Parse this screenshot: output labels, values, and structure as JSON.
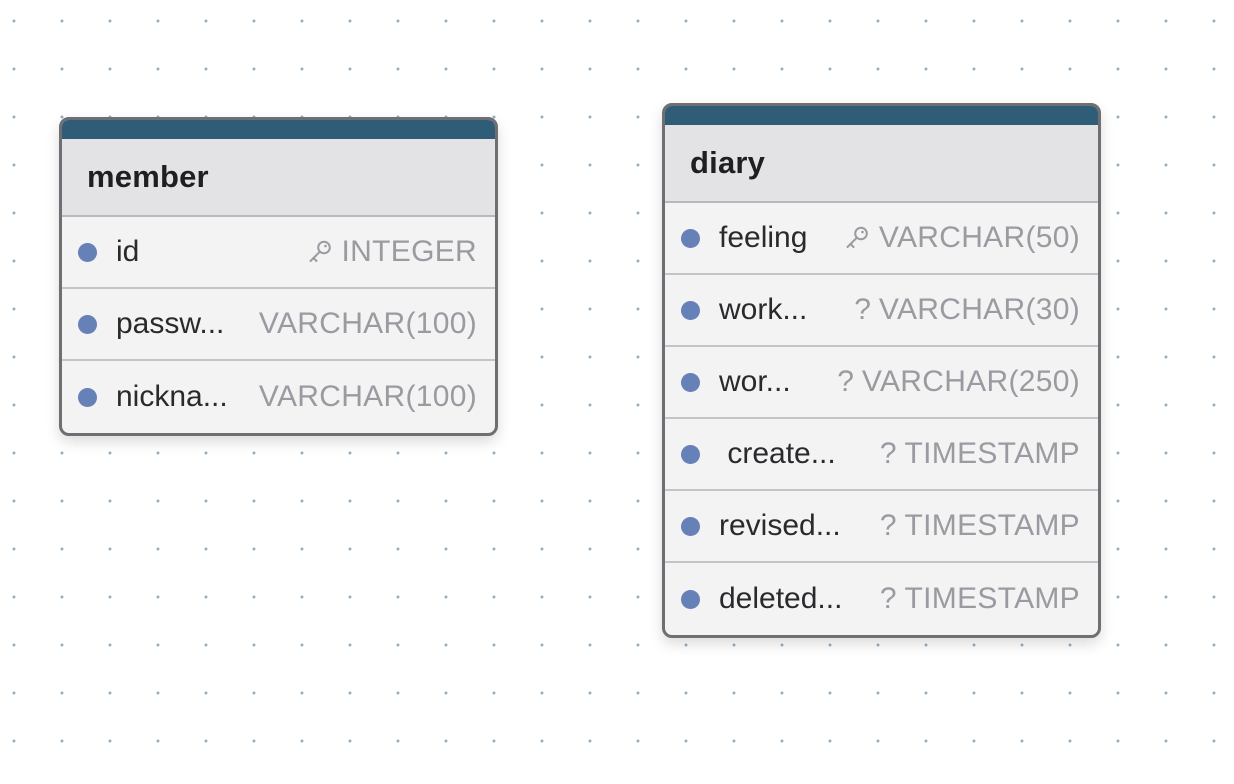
{
  "tables": [
    {
      "name": "member",
      "columns": [
        {
          "name": "id",
          "type": "INTEGER",
          "primary_key": true,
          "nullable": false
        },
        {
          "name": "passw...",
          "type": "VARCHAR(100)",
          "primary_key": false,
          "nullable": false
        },
        {
          "name": "nickna...",
          "type": "VARCHAR(100)",
          "primary_key": false,
          "nullable": false
        }
      ]
    },
    {
      "name": "diary",
      "columns": [
        {
          "name": "feeling",
          "type": "VARCHAR(50)",
          "primary_key": true,
          "nullable": false
        },
        {
          "name": "work...",
          "type": "VARCHAR(30)",
          "primary_key": false,
          "nullable": true,
          "nullable_mark": "?"
        },
        {
          "name": "wor...",
          "type": "VARCHAR(250)",
          "primary_key": false,
          "nullable": true,
          "nullable_mark": "?"
        },
        {
          "name": " create...",
          "type": "TIMESTAMP",
          "primary_key": false,
          "nullable": true,
          "nullable_mark": "?"
        },
        {
          "name": "revised...",
          "type": "TIMESTAMP",
          "primary_key": false,
          "nullable": true,
          "nullable_mark": "?"
        },
        {
          "name": "deleted...",
          "type": "TIMESTAMP",
          "primary_key": false,
          "nullable": true,
          "nullable_mark": "?"
        }
      ]
    }
  ],
  "colors": {
    "header_bar": "#2f5d78",
    "column_dot": "#6680b8",
    "type_text": "#9a9aa1",
    "grid_dot": "#8eb0c6"
  },
  "icons": {
    "primary_key": "key-icon"
  }
}
